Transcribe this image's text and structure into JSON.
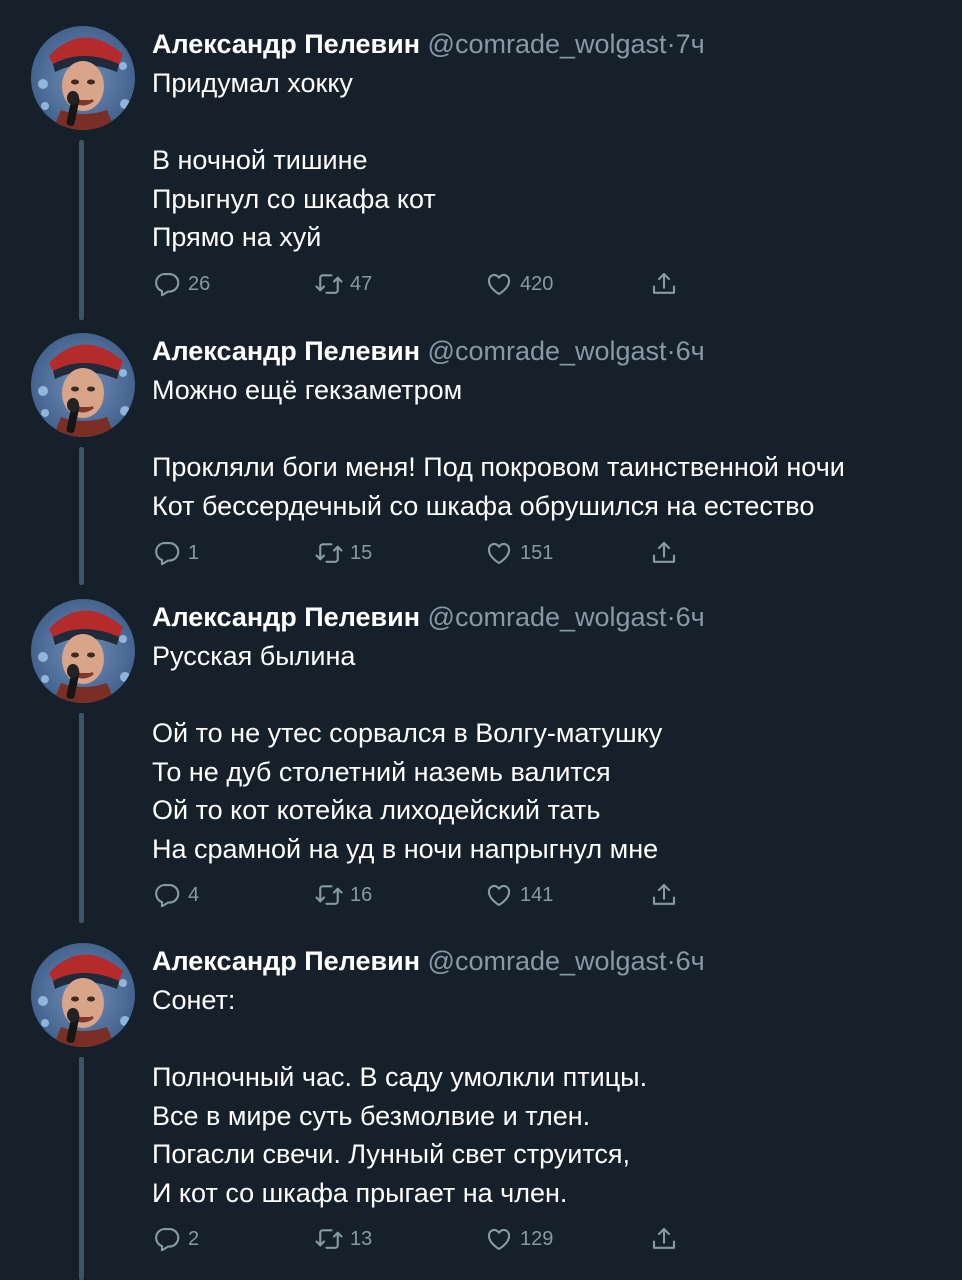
{
  "tweets": [
    {
      "author_name": "Александр Пелевин",
      "handle": "@comrade_wolgast",
      "separator": "·",
      "time": "7ч",
      "text": "Придумал хокку\n\nВ ночной тишине\nПрыгнул со шкафа кот\nПрямо на хуй",
      "replies": "26",
      "retweets": "47",
      "likes": "420"
    },
    {
      "author_name": "Александр Пелевин",
      "handle": "@comrade_wolgast",
      "separator": "·",
      "time": "6ч",
      "text": "Можно ещё гекзаметром\n\nПрокляли боги меня! Под покровом таинственной ночи\nКот бессердечный со шкафа обрушился на естество",
      "replies": "1",
      "retweets": "15",
      "likes": "151"
    },
    {
      "author_name": "Александр Пелевин",
      "handle": "@comrade_wolgast",
      "separator": "·",
      "time": "6ч",
      "text": "Русская былина\n\nОй то не утес сорвался в Волгу-матушку\nТо не дуб столетний наземь валится\nОй то кот котейка лиходейский тать\nНа срамной на уд в ночи напрыгнул мне",
      "replies": "4",
      "retweets": "16",
      "likes": "141"
    },
    {
      "author_name": "Александр Пелевин",
      "handle": "@comrade_wolgast",
      "separator": "·",
      "time": "6ч",
      "text": "Сонет:\n\nПолночный час. В саду умолкли птицы.\nВсе в мире суть безмолвие и тлен.\nПогасли свечи. Лунный свет струится,\nИ кот со шкафа прыгает на член.",
      "replies": "2",
      "retweets": "13",
      "likes": "129"
    }
  ],
  "icons": {
    "reply": "reply-icon",
    "retweet": "retweet-icon",
    "like": "heart-icon",
    "share": "share-icon"
  },
  "colors": {
    "background": "#15202b",
    "secondary_text": "#8899a6",
    "thread_line": "#3d5466",
    "avatar_background": "#4a6a94"
  }
}
